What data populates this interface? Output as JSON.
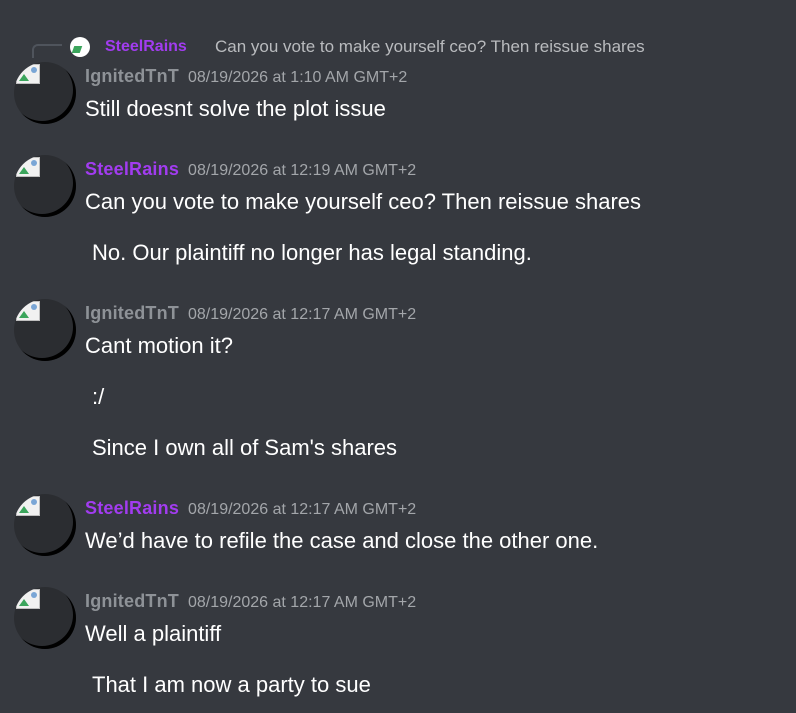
{
  "reply": {
    "author": "SteelRains",
    "text": "Can you vote to make yourself ceo? Then reissue shares"
  },
  "messages": [
    {
      "author": "IgnitedTnT",
      "timestamp": "08/19/2026 at 1:10 AM GMT+2",
      "lines": [
        "Still doesnt solve the plot issue"
      ]
    },
    {
      "author": "SteelRains",
      "timestamp": "08/19/2026 at 12:19 AM GMT+2",
      "lines": [
        "Can you vote to make yourself ceo? Then reissue shares",
        "No. Our plaintiff no longer has legal standing."
      ]
    },
    {
      "author": "IgnitedTnT",
      "timestamp": "08/19/2026 at 12:17 AM GMT+2",
      "lines": [
        "Cant motion it?",
        ":/",
        "Since I own all of Sam's shares"
      ]
    },
    {
      "author": "SteelRains",
      "timestamp": "08/19/2026 at 12:17 AM GMT+2",
      "lines": [
        "We’d have to refile the case and close the other one."
      ]
    },
    {
      "author": "IgnitedTnT",
      "timestamp": "08/19/2026 at 12:17 AM GMT+2",
      "lines": [
        "Well a plaintiff",
        "That I am now a party to sue"
      ]
    }
  ],
  "colors": {
    "background": "#36393f",
    "steelrains_name": "#a23cf0",
    "ignitedtnt_name": "#8e9297",
    "timestamp": "#a3a6aa",
    "message_text": "#ffffff"
  },
  "icons": [
    "reply-spine",
    "avatar-image"
  ]
}
